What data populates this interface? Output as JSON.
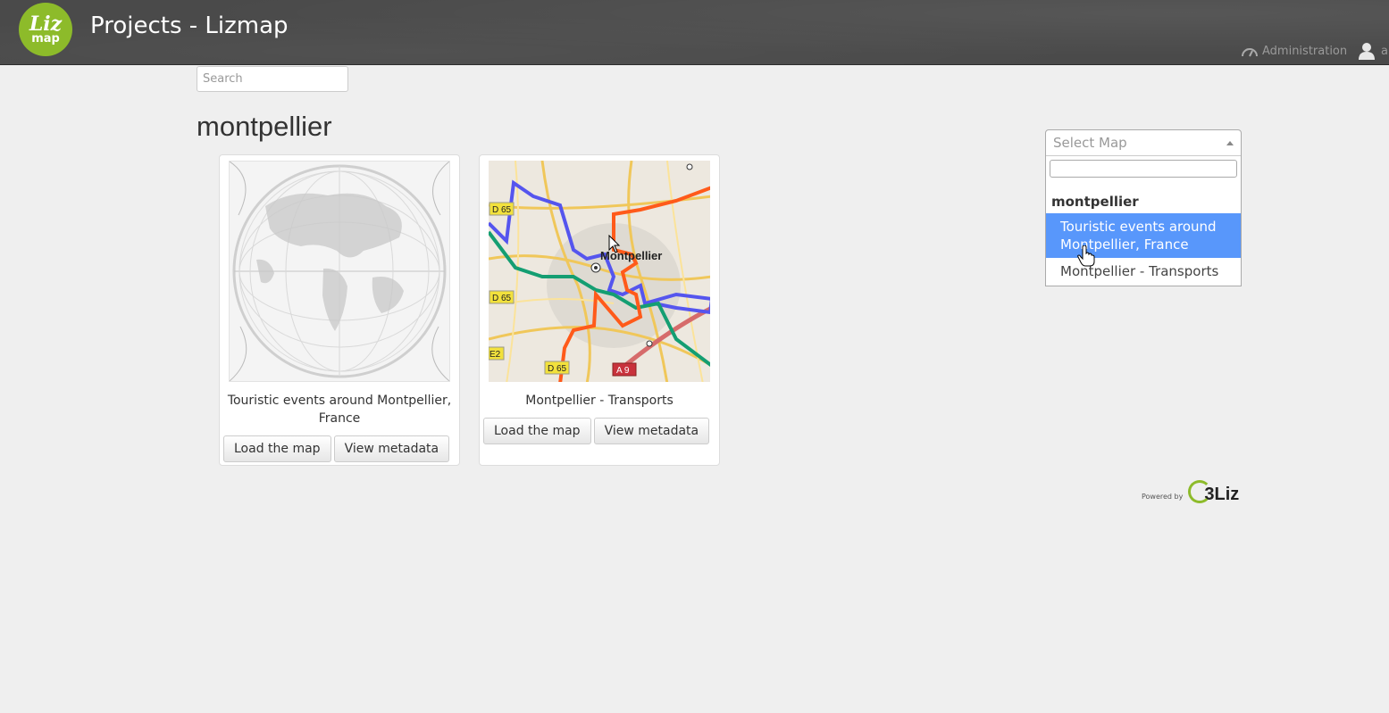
{
  "header": {
    "logo_top": "Liz",
    "logo_bottom": "map",
    "title": "Projects - Lizmap",
    "admin_label": "Administration",
    "user_label": "a"
  },
  "search": {
    "placeholder": "Search"
  },
  "section": {
    "title": "montpellier"
  },
  "projects": [
    {
      "title": "Touristic events around Montpellier, France",
      "load_label": "Load the map",
      "metadata_label": "View metadata"
    },
    {
      "title": "Montpellier - Transports",
      "load_label": "Load the map",
      "metadata_label": "View metadata"
    }
  ],
  "map_labels": {
    "city": "Montpellier",
    "road_d65_a": "D 65",
    "road_d65_b": "D 65",
    "road_d65_c": "D 65",
    "road_e2": "E2",
    "road_a9": "A 9"
  },
  "select_map": {
    "placeholder": "Select Map",
    "group": "montpellier",
    "options": [
      "Touristic events around Montpellier, France",
      "Montpellier - Transports"
    ],
    "highlighted_index": 0
  },
  "footer": {
    "powered_by": "Powered by",
    "brand": "3Liz"
  },
  "colors": {
    "header_bg": "#4a4a4a",
    "logo_green": "#8dbb2a",
    "highlight": "#5897fb"
  }
}
